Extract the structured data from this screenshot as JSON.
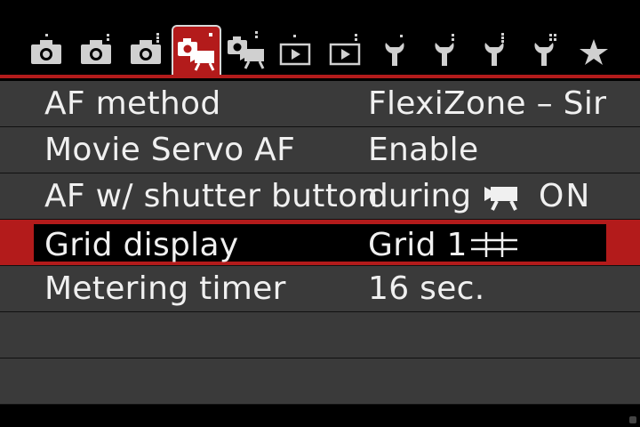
{
  "tabs": [
    {
      "icon": "camera-shoot-icon-1",
      "dots": 1,
      "active": false
    },
    {
      "icon": "camera-shoot-icon-2",
      "dots": 2,
      "active": false
    },
    {
      "icon": "camera-shoot-icon-3",
      "dots": 3,
      "active": false
    },
    {
      "icon": "live-view-movie-icon-1",
      "dots": 1,
      "active": true
    },
    {
      "icon": "live-view-movie-icon-2",
      "dots": 2,
      "active": false
    },
    {
      "icon": "playback-icon-1",
      "dots": 1,
      "active": false
    },
    {
      "icon": "playback-icon-2",
      "dots": 2,
      "active": false
    },
    {
      "icon": "setup-wrench-icon-1",
      "dots": 1,
      "active": false
    },
    {
      "icon": "setup-wrench-icon-2",
      "dots": 2,
      "active": false
    },
    {
      "icon": "setup-wrench-icon-3",
      "dots": 3,
      "active": false
    },
    {
      "icon": "setup-wrench-icon-4",
      "dots": 4,
      "active": false
    },
    {
      "icon": "my-menu-star-icon",
      "dots": 0,
      "active": false
    }
  ],
  "colors": {
    "accent": "#b31b1b",
    "row_bg": "#3a3a3a",
    "text": "#f0f0f0"
  },
  "menu": {
    "af_method": {
      "label": "AF method",
      "value": "FlexiZone – Single"
    },
    "movie_servo": {
      "label": "Movie Servo AF",
      "value": "Enable"
    },
    "af_shutter": {
      "label": "AF w/ shutter button",
      "value_prefix": "during",
      "value_suffix": "ON"
    },
    "grid": {
      "label": "Grid display",
      "value": "Grid 1"
    },
    "metering": {
      "label": "Metering timer",
      "value": "16 sec."
    }
  }
}
